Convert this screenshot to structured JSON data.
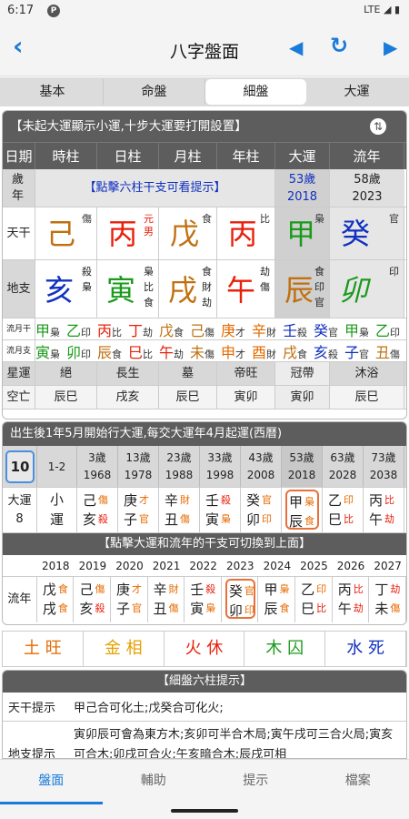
{
  "status": {
    "time": "6:17",
    "logo": "P",
    "lte": "LTE"
  },
  "toolbar": {
    "title": "八字盤面",
    "back": "‹",
    "prev": "◀",
    "refresh": "↻",
    "next": "▶"
  },
  "tabs": [
    {
      "label": "基本"
    },
    {
      "label": "命盤"
    },
    {
      "label": "細盤"
    },
    {
      "label": "大運"
    }
  ],
  "card1": {
    "header": "【未起大運顯示小運,十步大運要打開設置】",
    "cols": [
      "日期",
      "時柱",
      "日柱",
      "月柱",
      "年柱",
      "大運",
      "流年"
    ],
    "age_label": "歲年",
    "hint": "【點擊六柱干支可看提示】",
    "dayun_age": "53歲",
    "dayun_year": "2018",
    "liunian_age": "58歲",
    "liunian_year": "2023",
    "tiangan_label": "天干",
    "dizhi_label": "地支",
    "tiangan": [
      {
        "ch": "己",
        "tag": "傷",
        "color": "#c07010"
      },
      {
        "ch": "丙",
        "tag": "元男",
        "color": "#e8200c"
      },
      {
        "ch": "戊",
        "tag": "食",
        "color": "#c07010"
      },
      {
        "ch": "丙",
        "tag": "比",
        "color": "#e8200c"
      },
      {
        "ch": "甲",
        "tag": "梟",
        "color": "#1a9a1a"
      },
      {
        "ch": "癸",
        "tag": "官",
        "color": "#1030c0"
      }
    ],
    "dizhi": [
      {
        "ch": "亥",
        "tags": [
          "殺",
          "梟"
        ],
        "color": "#1030c0"
      },
      {
        "ch": "寅",
        "tags": [
          "梟",
          "比",
          "食"
        ],
        "color": "#1a9a1a"
      },
      {
        "ch": "戌",
        "tags": [
          "食",
          "財",
          "劫"
        ],
        "color": "#c07010"
      },
      {
        "ch": "午",
        "tags": [
          "劫",
          "傷"
        ],
        "color": "#e8200c"
      },
      {
        "ch": "辰",
        "tags": [
          "食",
          "印",
          "官"
        ],
        "color": "#c07010"
      },
      {
        "ch": "卯",
        "tags": [
          "印"
        ],
        "color": "#1a9a1a"
      }
    ],
    "liuyue_gan_label": "流月干",
    "liuyue_zhi_label": "流月支",
    "liuyue_gan": [
      [
        "甲",
        "梟",
        "#1a9a1a"
      ],
      [
        "乙",
        "印",
        "#1a9a1a"
      ],
      [
        "丙",
        "比",
        "#e8200c"
      ],
      [
        "丁",
        "劫",
        "#e8200c"
      ],
      [
        "戊",
        "食",
        "#c07010"
      ],
      [
        "己",
        "傷",
        "#c07010"
      ],
      [
        "庚",
        "才",
        "#e66a00"
      ],
      [
        "辛",
        "財",
        "#e66a00"
      ],
      [
        "壬",
        "殺",
        "#1030c0"
      ],
      [
        "癸",
        "官",
        "#1030c0"
      ],
      [
        "甲",
        "梟",
        "#1a9a1a"
      ],
      [
        "乙",
        "印",
        "#1a9a1a"
      ]
    ],
    "liuyue_zhi": [
      [
        "寅",
        "梟",
        "#1a9a1a"
      ],
      [
        "卯",
        "印",
        "#1a9a1a"
      ],
      [
        "辰",
        "食",
        "#c07010"
      ],
      [
        "巳",
        "比",
        "#e8200c"
      ],
      [
        "午",
        "劫",
        "#e8200c"
      ],
      [
        "未",
        "傷",
        "#c07010"
      ],
      [
        "申",
        "才",
        "#e66a00"
      ],
      [
        "酉",
        "財",
        "#e66a00"
      ],
      [
        "戌",
        "食",
        "#c07010"
      ],
      [
        "亥",
        "殺",
        "#1030c0"
      ],
      [
        "子",
        "官",
        "#1030c0"
      ],
      [
        "丑",
        "傷",
        "#c07010"
      ]
    ],
    "xingyun_label": "星運",
    "xingyun": [
      "絕",
      "長生",
      "墓",
      "帝旺",
      "冠帶",
      "沐浴"
    ],
    "kongwang_label": "空亡",
    "kongwang": [
      "辰巳",
      "戌亥",
      "辰巳",
      "寅卯",
      "寅卯",
      "辰巳"
    ]
  },
  "card2": {
    "header": "出生後1年5月開始行大運,每交大運年4月起運(西曆)",
    "first_box": "10",
    "small": "1-2",
    "ages": [
      [
        "3歲",
        "1968"
      ],
      [
        "13歲",
        "1978"
      ],
      [
        "23歲",
        "1988"
      ],
      [
        "33歲",
        "1998"
      ],
      [
        "43歲",
        "2008"
      ],
      [
        "53歲",
        "2018"
      ],
      [
        "63歲",
        "2028"
      ],
      [
        "73歲",
        "2038"
      ]
    ],
    "dayun_label": "大運",
    "dayun_num": "8",
    "xiaoyun": "小運",
    "dayun": [
      [
        "己",
        "傷",
        "亥",
        "殺"
      ],
      [
        "庚",
        "才",
        "子",
        "官"
      ],
      [
        "辛",
        "財",
        "丑",
        "傷"
      ],
      [
        "壬",
        "殺",
        "寅",
        "梟"
      ],
      [
        "癸",
        "官",
        "卯",
        "印"
      ],
      [
        "甲",
        "梟",
        "辰",
        "食"
      ],
      [
        "乙",
        "印",
        "巳",
        "比"
      ],
      [
        "丙",
        "比",
        "午",
        "劫"
      ]
    ],
    "switch_hint": "【點擊大運和流年的干支可切換到上面】",
    "years": [
      "2018",
      "2019",
      "2020",
      "2021",
      "2022",
      "2023",
      "2024",
      "2025",
      "2026",
      "2027"
    ],
    "liunian_label": "流年",
    "liunian": [
      [
        "戊",
        "食",
        "戌",
        "食"
      ],
      [
        "己",
        "傷",
        "亥",
        "殺"
      ],
      [
        "庚",
        "才",
        "子",
        "官"
      ],
      [
        "辛",
        "財",
        "丑",
        "傷"
      ],
      [
        "壬",
        "殺",
        "寅",
        "梟"
      ],
      [
        "癸",
        "官",
        "卯",
        "印"
      ],
      [
        "甲",
        "梟",
        "辰",
        "食"
      ],
      [
        "乙",
        "印",
        "巳",
        "比"
      ],
      [
        "丙",
        "比",
        "午",
        "劫"
      ],
      [
        "丁",
        "劫",
        "未",
        "傷"
      ]
    ]
  },
  "wuxing": [
    {
      "el": "土",
      "st": "旺",
      "color": "#e66a00"
    },
    {
      "el": "金",
      "st": "相",
      "color": "#e6a000"
    },
    {
      "el": "火",
      "st": "休",
      "color": "#e8200c"
    },
    {
      "el": "木",
      "st": "囚",
      "color": "#1a9a1a"
    },
    {
      "el": "水",
      "st": "死",
      "color": "#1030c0"
    }
  ],
  "card3": {
    "header": "【細盤六柱提示】",
    "tg_label": "天干提示",
    "tg_text": "甲己合可化土;戊癸合可化火;",
    "dz_label": "地支提示",
    "dz_text": "寅卯辰可會為東方木;亥卯可半合木局;寅午戌可三合火局;寅亥可合木;卯戌可合火;午亥暗合木;辰戌可相"
  },
  "bottom_nav": [
    {
      "label": "盤面"
    },
    {
      "label": "輔助"
    },
    {
      "label": "提示"
    },
    {
      "label": "檔案"
    }
  ]
}
